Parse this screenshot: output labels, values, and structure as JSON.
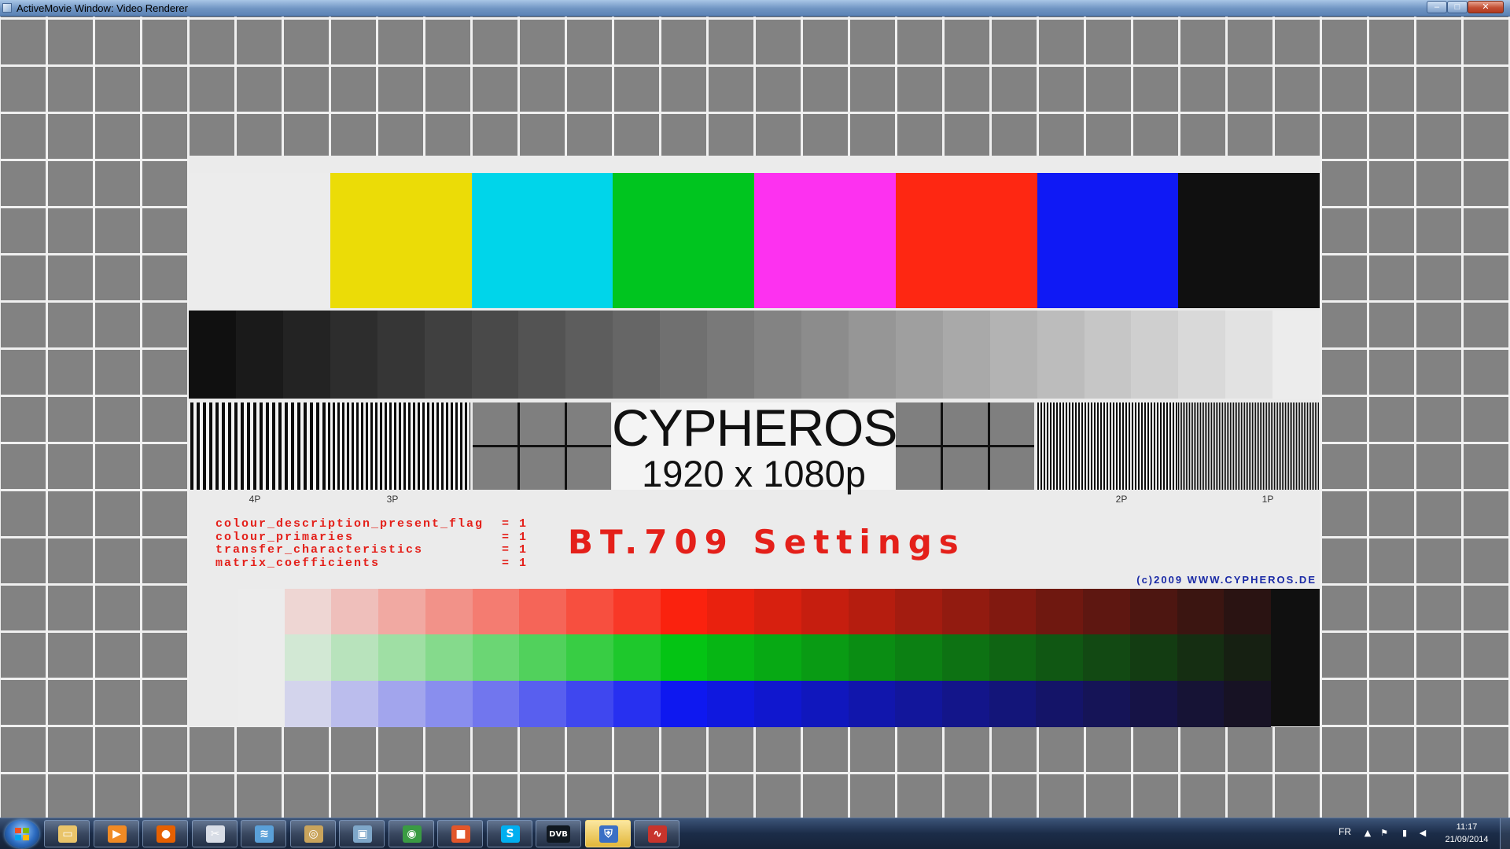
{
  "window": {
    "title": "ActiveMovie Window: Video Renderer",
    "minimize_glyph": "–",
    "maximize_glyph": "□",
    "close_glyph": "✕"
  },
  "test_card": {
    "logo": "CYPHEROS",
    "resolution": "1920 x 1080p",
    "stripe_labels": [
      "4P",
      "3P",
      "2P",
      "1P"
    ],
    "settings": [
      {
        "key": "colour_description_present_flag",
        "value": "= 1"
      },
      {
        "key": "colour_primaries",
        "value": "= 1"
      },
      {
        "key": "transfer_characteristics",
        "value": "= 1"
      },
      {
        "key": "matrix_coefficients",
        "value": "= 1"
      }
    ],
    "heading": "BT.709 Settings",
    "copyright": "(c)2009 WWW.CYPHEROS.DE",
    "color_bars": [
      "#ececec",
      "#ebdc07",
      "#00d5ea",
      "#00c51f",
      "#fd31f0",
      "#fe2712",
      "#0f19f5",
      "#101010"
    ],
    "gray_ramp_steps": 24,
    "gradient_steps": 22,
    "colors": {
      "accent_red": "#e4201a",
      "copyright_blue": "#1a2aa6"
    }
  },
  "taskbar": {
    "start_icon": "windows-logo-icon",
    "apps": [
      {
        "name": "file-explorer-icon",
        "color": "#e9c46a",
        "glyph": "▭"
      },
      {
        "name": "media-player-icon",
        "color": "#f08a24",
        "glyph": "▶"
      },
      {
        "name": "firefox-icon",
        "color": "#e66000",
        "glyph": "●"
      },
      {
        "name": "screenshot-tool-icon",
        "color": "#d8dde6",
        "glyph": "✂"
      },
      {
        "name": "network-app-icon",
        "color": "#5aa0d8",
        "glyph": "≋"
      },
      {
        "name": "globe-app-icon",
        "color": "#c9a45c",
        "glyph": "◎"
      },
      {
        "name": "window-app-icon",
        "color": "#7fa7c9",
        "glyph": "▣"
      },
      {
        "name": "chrome-icon",
        "color": "#3a9b43",
        "glyph": "◉"
      },
      {
        "name": "office-icon",
        "color": "#e2562a",
        "glyph": "■"
      },
      {
        "name": "skype-icon",
        "color": "#00aff0",
        "glyph": "S"
      },
      {
        "name": "dvb-app-icon",
        "color": "#101820",
        "glyph": "DVB"
      },
      {
        "name": "security-shield-icon",
        "color": "#3b6fc5",
        "glyph": "⛨"
      },
      {
        "name": "monitor-graph-icon",
        "color": "#c8342c",
        "glyph": "∿"
      }
    ],
    "language": "FR",
    "time": "11:17",
    "date": "21/09/2014",
    "tray_icons": [
      "show-hidden-icons-icon",
      "flag-icon",
      "network-signal-icon",
      "volume-icon"
    ]
  }
}
